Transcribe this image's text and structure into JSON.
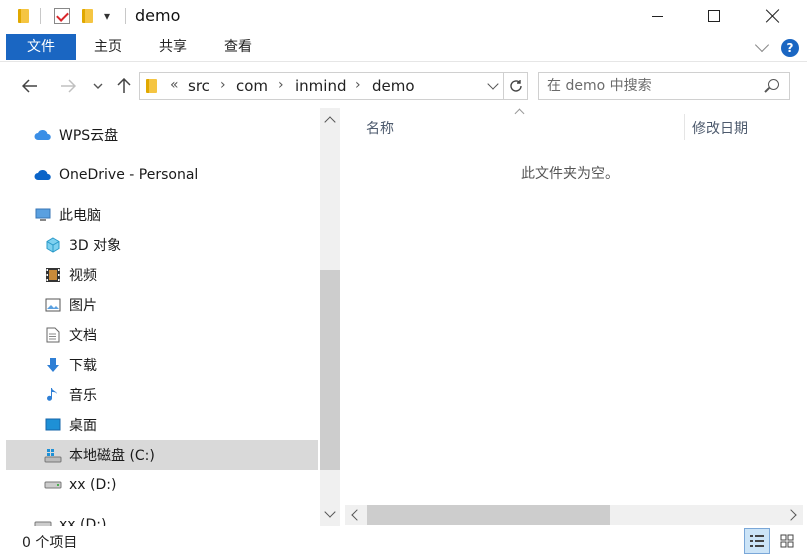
{
  "window": {
    "title": "demo",
    "qa_dropdown": "▾"
  },
  "ribbon": {
    "tabs": [
      {
        "label": "文件"
      },
      {
        "label": "主页"
      },
      {
        "label": "共享"
      },
      {
        "label": "查看"
      }
    ],
    "help": "?"
  },
  "address": {
    "overflow": "«",
    "crumbs": [
      "src",
      "com",
      "inmind",
      "demo"
    ],
    "separator": "›"
  },
  "search": {
    "placeholder": "在 demo 中搜索"
  },
  "nav": {
    "items": [
      {
        "label": "WPS云盘",
        "icon": "cloud-icon"
      },
      {
        "label": "OneDrive - Personal",
        "icon": "onedrive-icon"
      },
      {
        "label": "此电脑",
        "icon": "computer-icon"
      },
      {
        "label": "3D 对象",
        "icon": "cube-3d-icon"
      },
      {
        "label": "视频",
        "icon": "film-icon"
      },
      {
        "label": "图片",
        "icon": "picture-icon"
      },
      {
        "label": "文档",
        "icon": "document-icon"
      },
      {
        "label": "下载",
        "icon": "download-icon"
      },
      {
        "label": "音乐",
        "icon": "music-icon"
      },
      {
        "label": "桌面",
        "icon": "desktop-icon"
      },
      {
        "label": "本地磁盘 (C:)",
        "icon": "system-drive-icon",
        "selected": true
      },
      {
        "label": "xx (D:)",
        "icon": "drive-icon"
      },
      {
        "label": "xx (D:)",
        "icon": "drive-icon"
      }
    ]
  },
  "content": {
    "columns": [
      "名称",
      "修改日期"
    ],
    "empty_message": "此文件夹为空。"
  },
  "status": {
    "text": "0 个项目"
  },
  "colors": {
    "accent": "#1a66c2",
    "selected_bg": "#d9d9d9",
    "folder": "#f5c542"
  }
}
